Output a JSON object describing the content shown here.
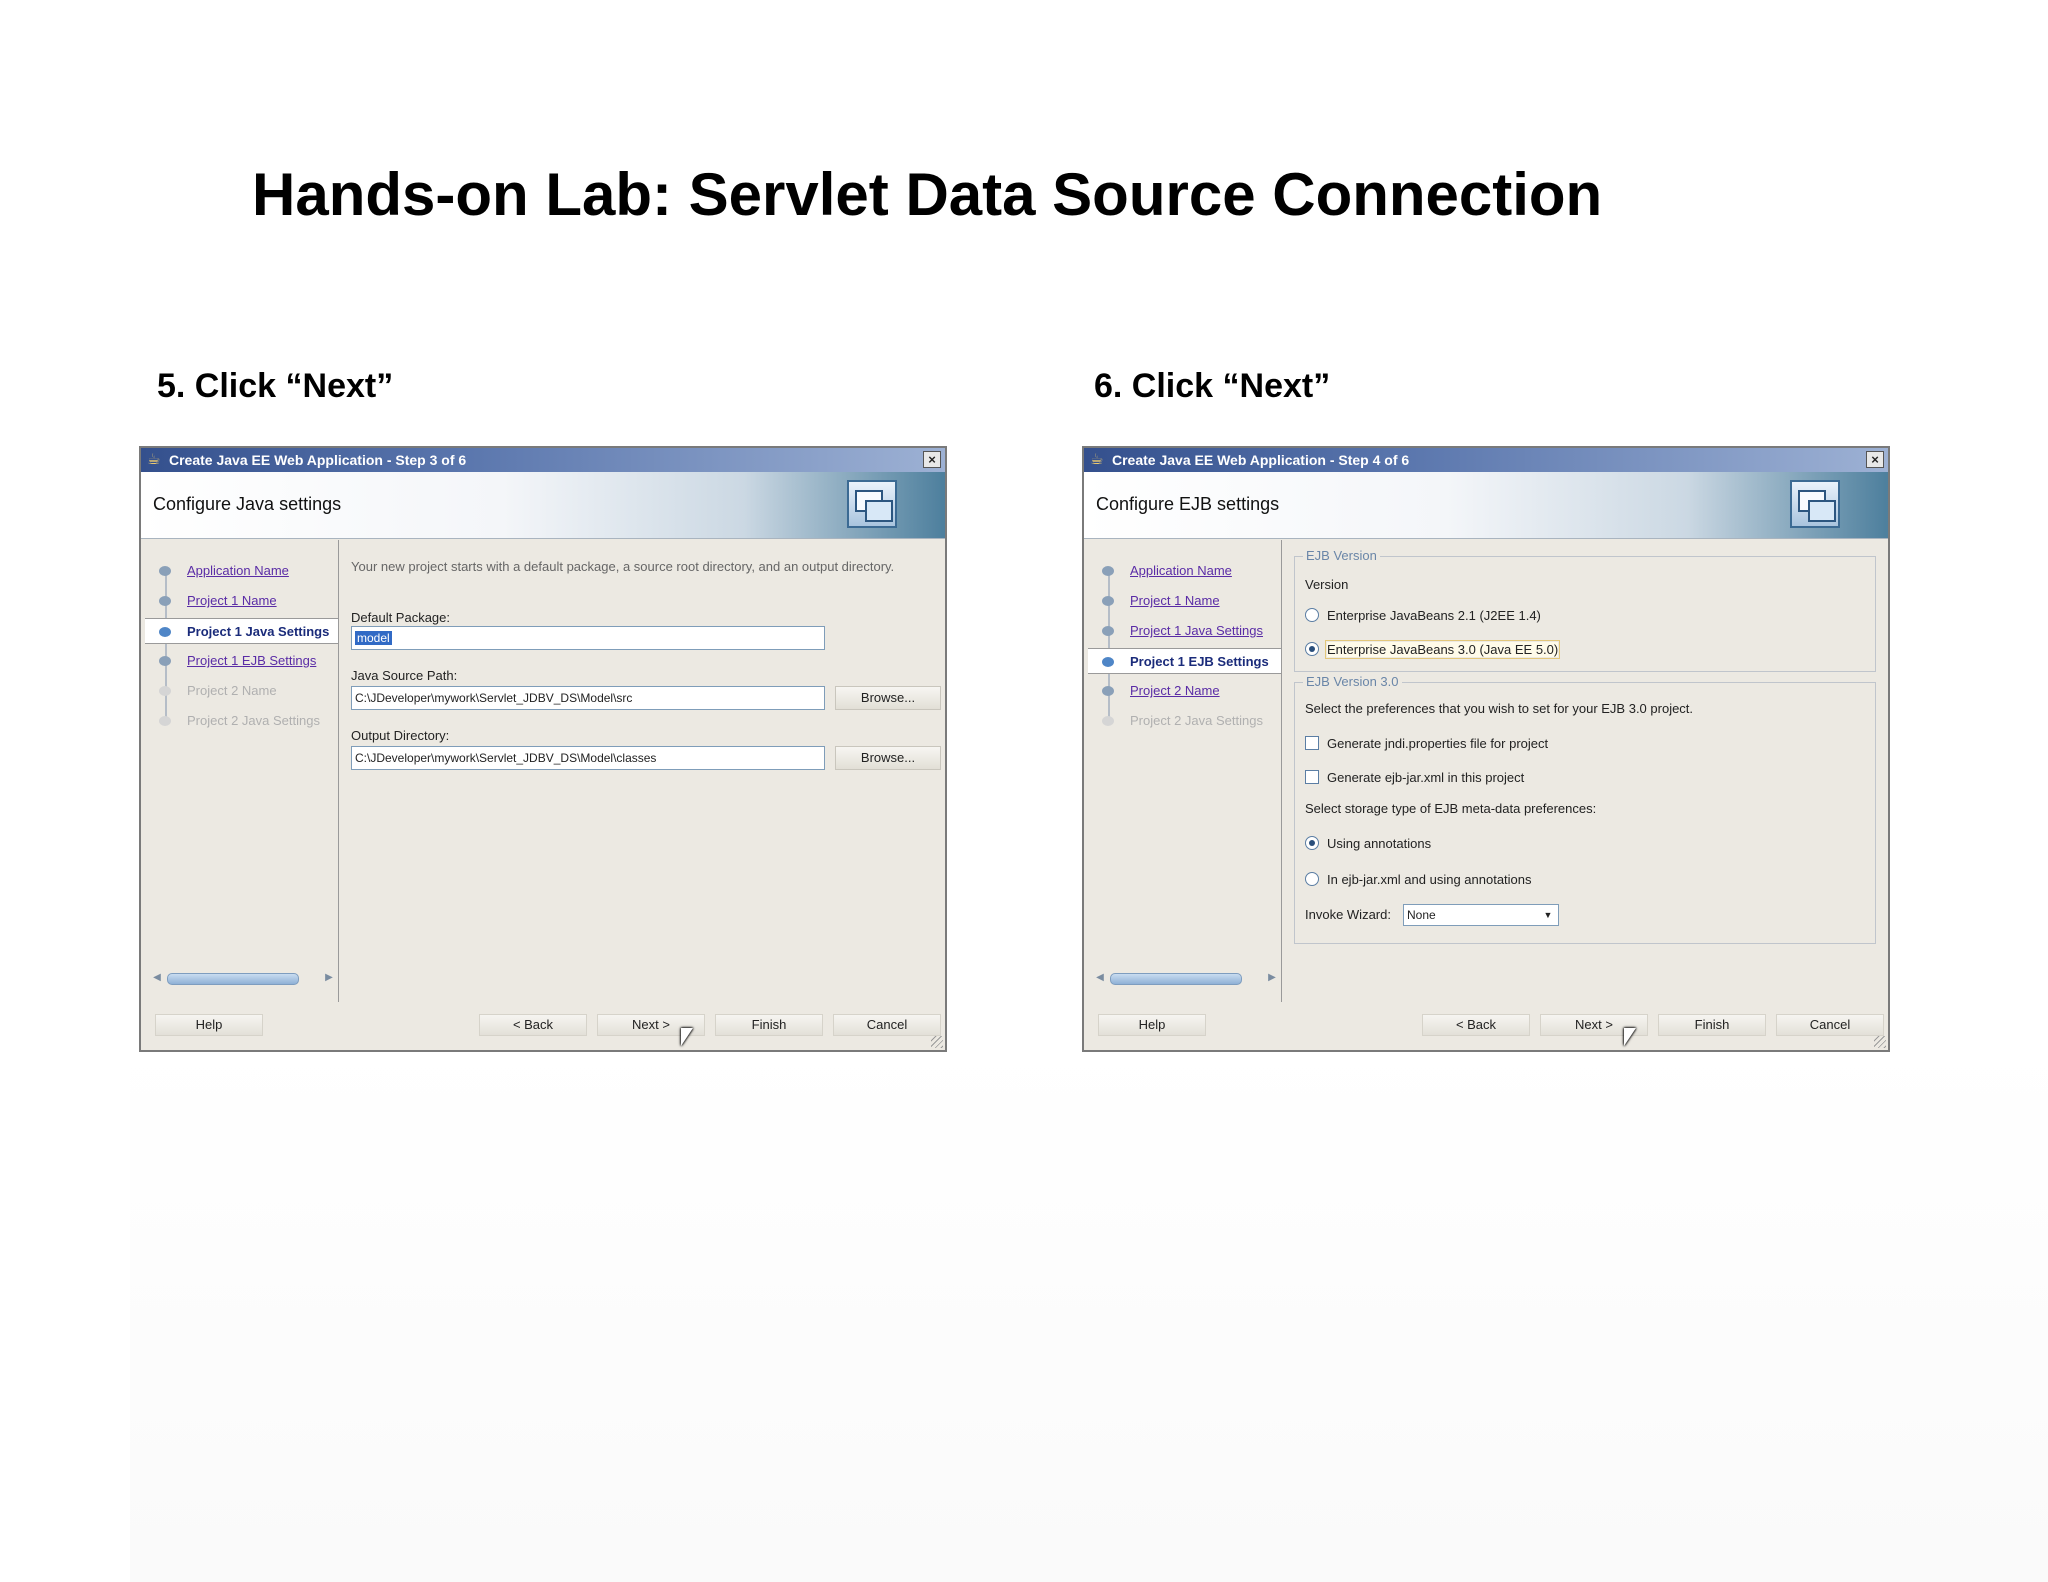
{
  "slide": {
    "title": "Hands-on Lab: Servlet Data Source Connection",
    "step5_caption": "5. Click “Next”",
    "step6_caption": "6. Click “Next”"
  },
  "dialog5": {
    "window_title": "Create Java EE Web Application - Step 3 of 6",
    "banner_heading": "Configure Java settings",
    "nav": [
      {
        "label": "Application Name",
        "state": "link"
      },
      {
        "label": "Project 1 Name",
        "state": "link"
      },
      {
        "label": "Project 1 Java Settings",
        "state": "current"
      },
      {
        "label": "Project 1 EJB Settings",
        "state": "link"
      },
      {
        "label": "Project 2 Name",
        "state": "disabled"
      },
      {
        "label": "Project 2 Java Settings",
        "state": "disabled"
      }
    ],
    "intro_text": "Your new project starts with a default package, a source root directory, and an output directory.",
    "default_package_label": "Default Package:",
    "default_package_value": "model",
    "java_source_path_label": "Java Source Path:",
    "java_source_path_value": "C:\\JDeveloper\\mywork\\Servlet_JDBV_DS\\Model\\src",
    "output_directory_label": "Output Directory:",
    "output_directory_value": "C:\\JDeveloper\\mywork\\Servlet_JDBV_DS\\Model\\classes",
    "browse_label": "Browse...",
    "buttons": {
      "help": "Help",
      "back": "< Back",
      "next": "Next >",
      "finish": "Finish",
      "cancel": "Cancel"
    }
  },
  "dialog6": {
    "window_title": "Create Java EE Web Application - Step 4 of 6",
    "banner_heading": "Configure EJB settings",
    "nav": [
      {
        "label": "Application Name",
        "state": "link"
      },
      {
        "label": "Project 1 Name",
        "state": "link"
      },
      {
        "label": "Project 1 Java Settings",
        "state": "link"
      },
      {
        "label": "Project 1 EJB Settings",
        "state": "current"
      },
      {
        "label": "Project 2 Name",
        "state": "link"
      },
      {
        "label": "Project 2 Java Settings",
        "state": "disabled"
      }
    ],
    "ejb_version_group": "EJB Version",
    "version_label": "Version",
    "option_ejb21": "Enterprise JavaBeans 2.1 (J2EE 1.4)",
    "option_ejb30": "Enterprise JavaBeans 3.0 (Java EE 5.0)",
    "ejb30_group": "EJB Version 3.0",
    "preferences_text": "Select the preferences that you wish to set for your EJB 3.0 project.",
    "check_jndi": "Generate jndi.properties file for project",
    "check_ejbjar": "Generate ejb-jar.xml in this project",
    "storage_text": "Select storage type of EJB meta-data preferences:",
    "radio_annotations": "Using annotations",
    "radio_ejbjar_annotations": "In ejb-jar.xml and using annotations",
    "invoke_wizard_label": "Invoke Wizard:",
    "invoke_wizard_value": "None",
    "buttons": {
      "help": "Help",
      "back": "< Back",
      "next": "Next >",
      "finish": "Finish",
      "cancel": "Cancel"
    }
  }
}
